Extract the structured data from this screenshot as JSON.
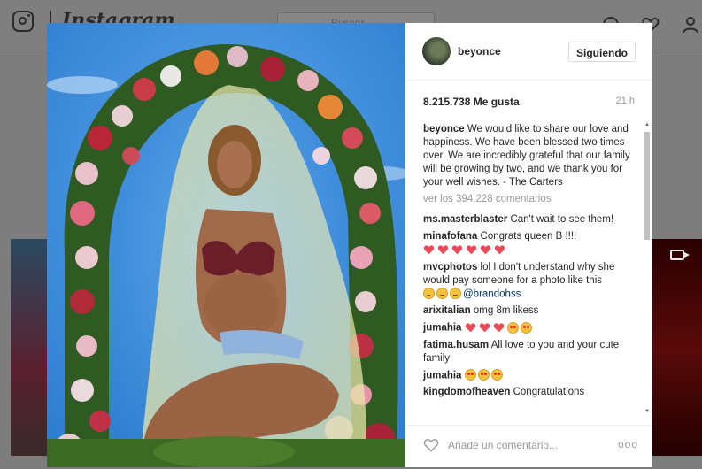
{
  "background": {
    "wordmark": "Instagram",
    "search_placeholder": "Buscar"
  },
  "post": {
    "username": "beyonce",
    "follow_label": "Siguiendo",
    "likes": "8.215.738 Me gusta",
    "time": "21 h",
    "caption_user": "beyonce",
    "caption_text": "We would like to share our love and happiness. We have been blessed two times over. We are incredibly grateful that our family will be growing by two, and we thank you for your well wishes. - The Carters",
    "view_all": "ver los 394.228 comentarios",
    "comments": [
      {
        "user": "ms.masterblaster",
        "text": "Can't wait to see them!"
      },
      {
        "user": "minafofana",
        "text": "Congrats queen B !!!!",
        "emoji": [
          "heart",
          "heart",
          "heart",
          "heart",
          "heart",
          "heart"
        ]
      },
      {
        "user": "mvcphotos",
        "text": "lol I don't understand why she would pay someone for a photo like this",
        "emoji": [
          "sad",
          "flat",
          "flat"
        ],
        "mention": "@brandohss"
      },
      {
        "user": "arixitalian",
        "text": "omg 8m likess"
      },
      {
        "user": "jumahia",
        "text": "",
        "emoji": [
          "heart",
          "heart",
          "heart",
          "heart-eyes",
          "heart-eyes"
        ]
      },
      {
        "user": "fatima.husam",
        "text": "All love to you and your cute family"
      },
      {
        "user": "jumahia",
        "text": "",
        "emoji": [
          "heart-eyes",
          "heart-eyes",
          "heart-eyes"
        ]
      },
      {
        "user": "kingdomofheaven",
        "text": "Congratulations"
      }
    ],
    "add_comment_placeholder": "Añade un comentario...",
    "more_label": "ooo"
  },
  "colors": {
    "heart": "#ed4956",
    "link": "#003569",
    "muted": "#999999"
  }
}
